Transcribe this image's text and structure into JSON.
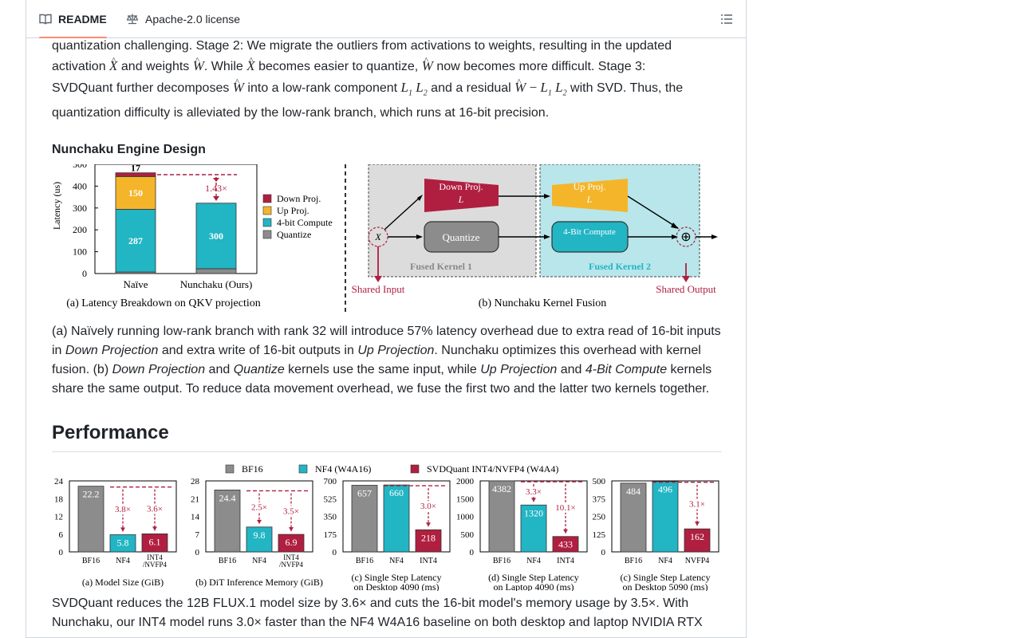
{
  "tabs": {
    "readme": "README",
    "license": "Apache-2.0 license"
  },
  "intro": {
    "line1": "quantization challenging. Stage 2: We migrate the outliers from activations to weights, resulting in the updated",
    "activation_word": "activation",
    "and_weights": "and weights",
    "while": ". While",
    "becomes_easier": "becomes easier to quantize,",
    "now_harder": "now becomes more difficult. Stage 3:",
    "svdquant_decomp": "SVDQuant further decomposes",
    "into_lowrank": "into a low-rank component",
    "and_residual": "and a residual",
    "with_svd": "with SVD. Thus, the",
    "line4": "quantization difficulty is alleviated by the low-rank branch, which runs at 16-bit precision.",
    "sym_X": "X",
    "sym_W": "W",
    "sym_L1": "L",
    "sym_L2": "L",
    "sub1": "1",
    "sub2": "2",
    "minus": "−"
  },
  "engine": {
    "heading": "Nunchaku Engine Design",
    "figure_a": {
      "ylabel": "Latency (us)",
      "yticks": [
        "0",
        "100",
        "200",
        "300",
        "400",
        "500"
      ],
      "bars": [
        {
          "name": "Naïve",
          "quantize": 7,
          "compute": 287,
          "up": 150,
          "down": 17
        },
        {
          "name": "Nunchaku (Ours)",
          "quantize": 22,
          "compute": 300
        }
      ],
      "ratio_label": "1.43×",
      "legend": [
        "Down Proj.",
        "Up Proj.",
        "4-bit Compute",
        "Quantize"
      ],
      "caption": "(a) Latency Breakdown on QKV projection"
    },
    "figure_b": {
      "down_proj": "Down Proj.",
      "up_proj": "Up Proj.",
      "quantize": "Quantize",
      "compute": "4-Bit Compute",
      "fused1": "Fused Kernel 1",
      "fused2": "Fused Kernel 2",
      "shared_input": "Shared Input",
      "shared_output": "Shared Output",
      "caption": "(b) Nunchaku Kernel Fusion"
    },
    "desc": {
      "p1": "(a) Naïvely running low-rank branch with rank 32 will introduce 57% latency overhead due to extra read of 16-bit inputs in ",
      "down_projection": "Down Projection",
      "p2": " and extra write of 16-bit outputs in ",
      "up_projection": "Up Projection",
      "p3": ". Nunchaku optimizes this overhead with kernel fusion. (b) ",
      "down_projection2": "Down Projection",
      "and1": " and ",
      "quantize": "Quantize",
      "p4": " kernels use the same input, while ",
      "up_projection2": "Up Projection",
      "and2": " and ",
      "four_bit": "4-Bit Compute",
      "p5": " kernels share the same output. To reduce data movement overhead, we fuse the first two and the latter two kernels together."
    }
  },
  "performance": {
    "heading": "Performance",
    "legend": [
      "BF16",
      "NF4 (W4A16)",
      "SVDQuant INT4/NVFP4 (W4A4)"
    ],
    "colors": {
      "bf16": "#8c8c8c",
      "nf4": "#22b5c4",
      "svdq": "#b01f40"
    },
    "text": "SVDQuant reduces the 12B FLUX.1 model size by 3.6× and cuts the 16-bit model's memory usage by 3.5×. With Nunchaku, our INT4 model runs 3.0× faster than the NF4 W4A16 baseline on both desktop and laptop NVIDIA RTX"
  },
  "chart_data": [
    {
      "type": "bar",
      "title": "(a) Model Size (GiB)",
      "categories": [
        "BF16",
        "NF4",
        "INT4 /NVFP4"
      ],
      "values": [
        22.2,
        5.8,
        6.1
      ],
      "ylim": [
        0,
        24
      ],
      "yticks": [
        "0",
        "6",
        "12",
        "18",
        "24"
      ],
      "annotations": [
        "3.8×",
        "3.6×"
      ]
    },
    {
      "type": "bar",
      "title": "(b) DiT Inference Memory (GiB)",
      "categories": [
        "BF16",
        "NF4",
        "INT4 /NVFP4"
      ],
      "values": [
        24.4,
        9.8,
        6.9
      ],
      "ylim": [
        0,
        28
      ],
      "yticks": [
        "0",
        "7",
        "14",
        "21",
        "28"
      ],
      "annotations": [
        "2.5×",
        "3.5×"
      ]
    },
    {
      "type": "bar",
      "title": "(c) Single Step Latency on Desktop 4090 (ms)",
      "categories": [
        "BF16",
        "NF4",
        "INT4"
      ],
      "values": [
        657,
        660,
        218
      ],
      "ylim": [
        0,
        700
      ],
      "yticks": [
        "0",
        "175",
        "350",
        "525",
        "700"
      ],
      "annotations": [
        "3.0×"
      ]
    },
    {
      "type": "bar",
      "title": "(d) Single Step Latency on Laptop 4090 (ms)",
      "categories": [
        "BF16",
        "NF4",
        "INT4"
      ],
      "values": [
        4382,
        1320,
        433
      ],
      "ylim": [
        0,
        2000
      ],
      "yticks": [
        "0",
        "500",
        "1000",
        "1500",
        "2000"
      ],
      "annotations": [
        "3.3×",
        "10.1×"
      ]
    },
    {
      "type": "bar",
      "title": "(c) Single Step Latency on Desktop 5090 (ms)",
      "categories": [
        "BF16",
        "NF4",
        "NVFP4"
      ],
      "values": [
        484,
        496,
        162
      ],
      "ylim": [
        0,
        500
      ],
      "yticks": [
        "0",
        "125",
        "250",
        "375",
        "500"
      ],
      "annotations": [
        "3.1×"
      ]
    }
  ]
}
